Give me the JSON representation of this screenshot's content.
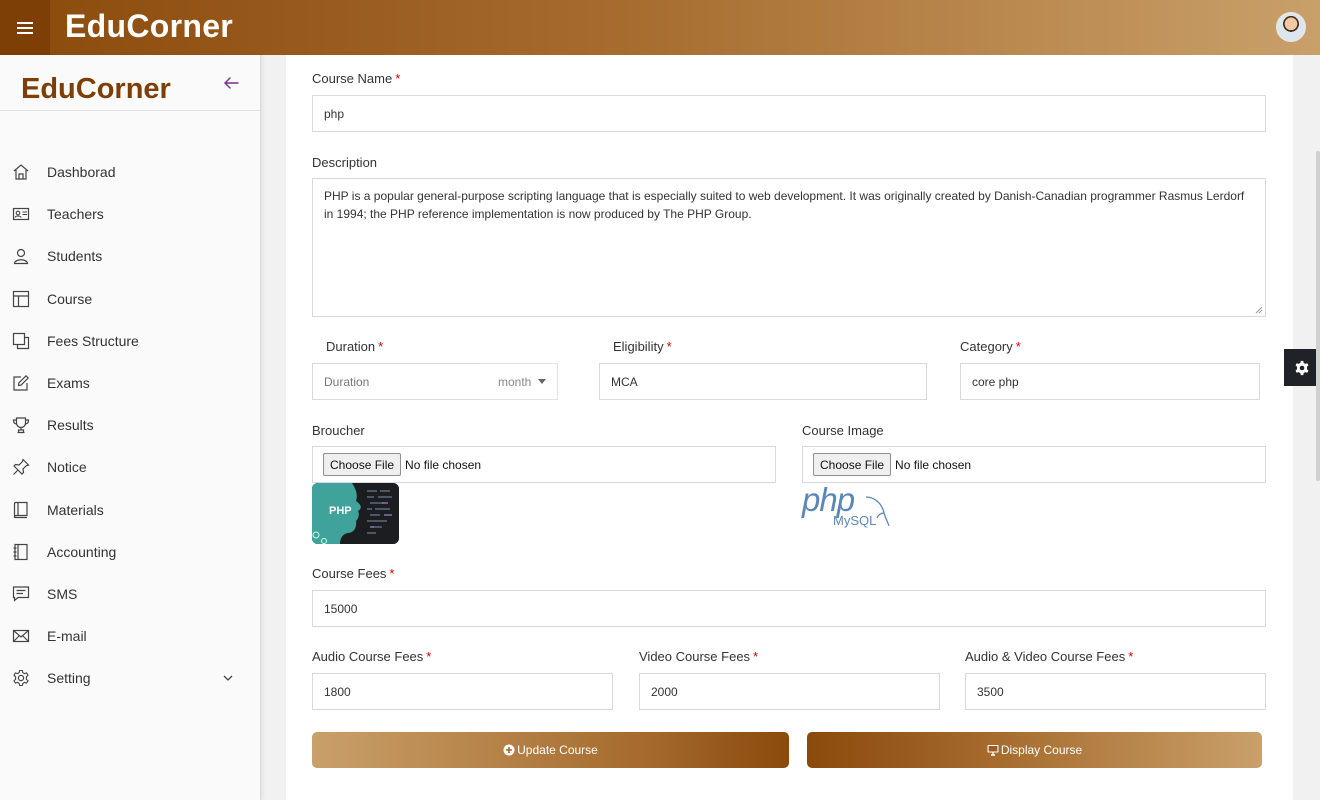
{
  "header": {
    "brand": "EduCorner",
    "menu_icon": "hamburger-icon",
    "avatar_icon": "user-avatar"
  },
  "sidebar": {
    "brand": "EduCorner",
    "back_icon": "arrow-left-icon",
    "items": [
      {
        "label": "Dashborad",
        "icon": "home-icon"
      },
      {
        "label": "Teachers",
        "icon": "id-card-icon"
      },
      {
        "label": "Students",
        "icon": "user-icon"
      },
      {
        "label": "Course",
        "icon": "layout-icon"
      },
      {
        "label": "Fees Structure",
        "icon": "copy-icon"
      },
      {
        "label": "Exams",
        "icon": "edit-icon"
      },
      {
        "label": "Results",
        "icon": "trophy-icon"
      },
      {
        "label": "Notice",
        "icon": "pin-icon"
      },
      {
        "label": "Materials",
        "icon": "book-icon"
      },
      {
        "label": "Accounting",
        "icon": "notebook-icon"
      },
      {
        "label": "SMS",
        "icon": "message-icon"
      },
      {
        "label": "E-mail",
        "icon": "mail-icon"
      },
      {
        "label": "Setting",
        "icon": "gear-icon",
        "has_submenu": true
      }
    ]
  },
  "form": {
    "course_name": {
      "label": "Course Name",
      "required": "*",
      "value": "php"
    },
    "description": {
      "label": "Description",
      "value": "PHP is a popular general-purpose scripting language that is especially suited to web development. It was originally created by Danish-Canadian programmer Rasmus Lerdorf in 1994; the PHP reference implementation is now produced by The PHP Group."
    },
    "duration": {
      "label": "Duration",
      "required": "*",
      "placeholder": "Duration",
      "unit": "month"
    },
    "eligibility": {
      "label": "Eligibility",
      "required": "*",
      "value": "MCA"
    },
    "category": {
      "label": "Category",
      "required": "*",
      "value": "core php"
    },
    "broucher": {
      "label": "Broucher",
      "button": "Choose File",
      "status": "No file chosen",
      "preview_text": "PHP"
    },
    "course_image": {
      "label": "Course Image",
      "button": "Choose File",
      "status": "No file chosen",
      "preview_logo": "php",
      "preview_sub": "MySQL"
    },
    "course_fees": {
      "label": "Course Fees",
      "required": "*",
      "value": "15000"
    },
    "audio_fees": {
      "label": "Audio Course Fees",
      "required": "*",
      "value": "1800"
    },
    "video_fees": {
      "label": "Video Course Fees",
      "required": "*",
      "value": "2000"
    },
    "av_fees": {
      "label": "Audio & Video Course Fees",
      "required": "*",
      "value": "3500"
    }
  },
  "actions": {
    "update": {
      "label": "Update Course",
      "icon": "plus-circle-icon"
    },
    "display": {
      "label": "Display Course",
      "icon": "monitor-icon"
    }
  },
  "settings_tab": {
    "icon": "gear-icon"
  },
  "colors": {
    "brand_dark": "#7d3f06",
    "brand_light": "#c9a06a",
    "required": "#d40000"
  }
}
